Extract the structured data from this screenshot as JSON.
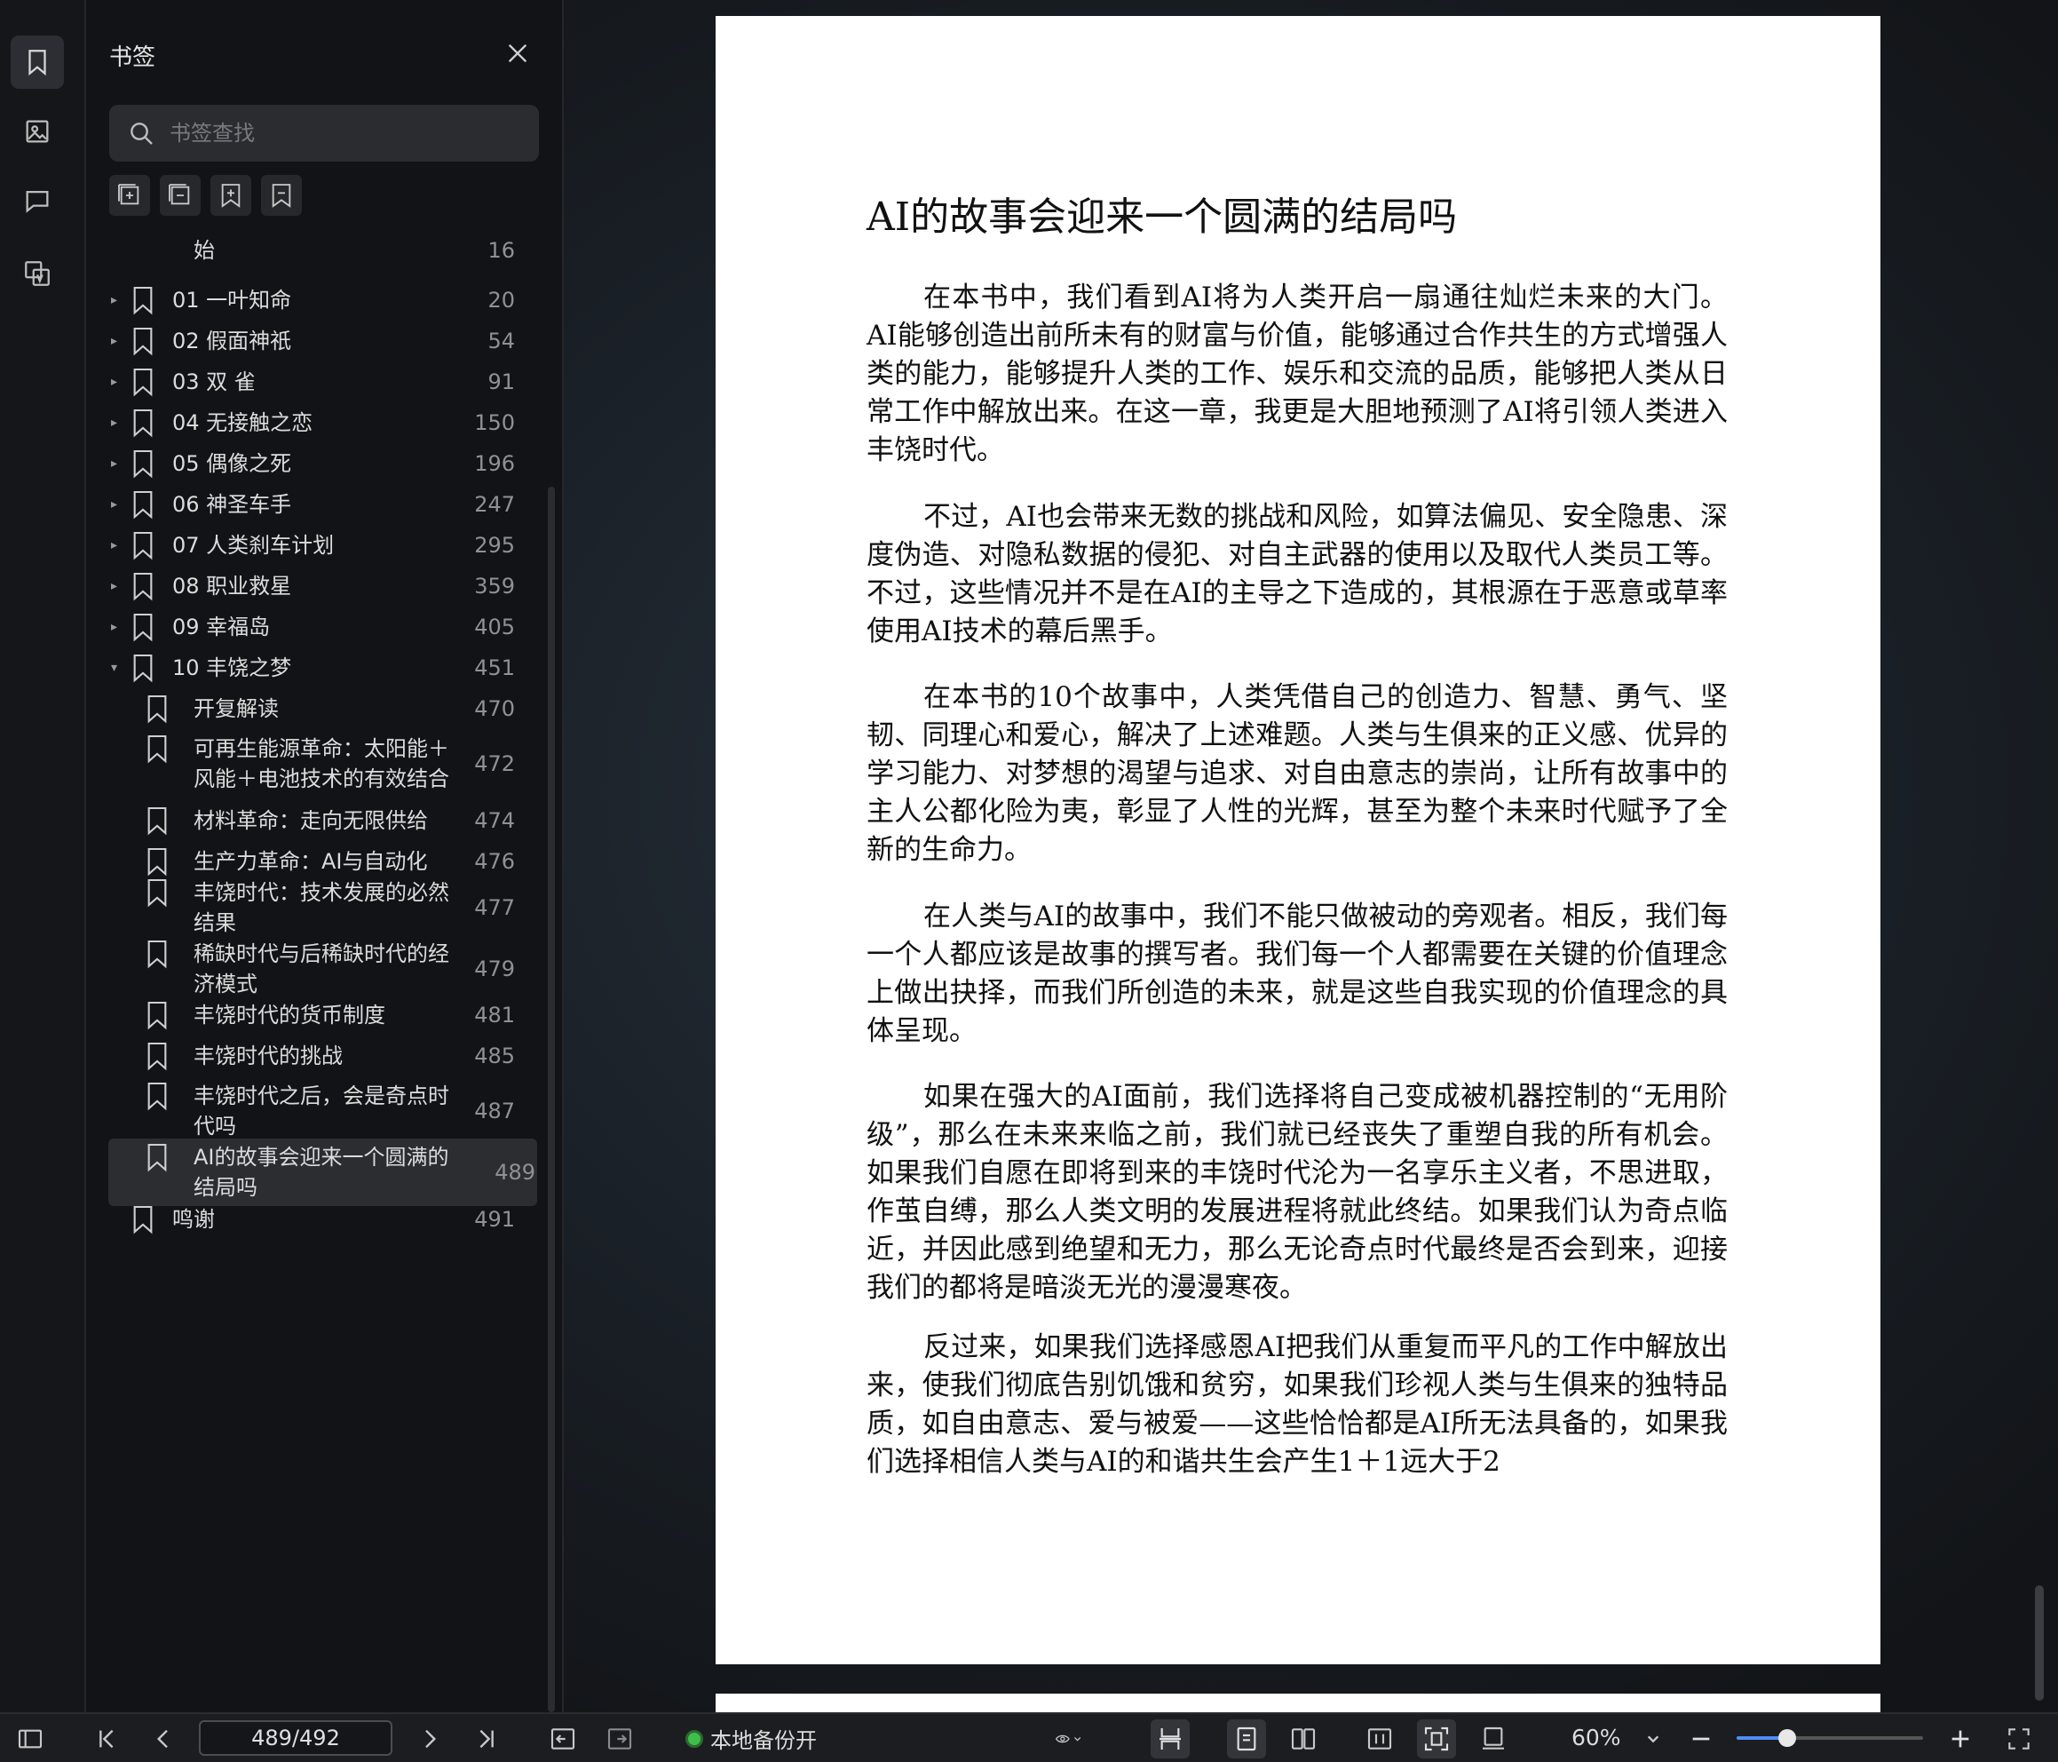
{
  "sidebar": {
    "title": "书签",
    "search_placeholder": "书签查找",
    "items": [
      {
        "label": "始",
        "page": "16",
        "level": 2,
        "arrow": "",
        "icon": false
      },
      {
        "label": "01 一叶知命",
        "page": "20",
        "level": 1,
        "arrow": "▸",
        "icon": true
      },
      {
        "label": "02 假面神祇",
        "page": "54",
        "level": 1,
        "arrow": "▸",
        "icon": true
      },
      {
        "label": "03 双 雀",
        "page": "91",
        "level": 1,
        "arrow": "▸",
        "icon": true
      },
      {
        "label": "04 无接触之恋",
        "page": "150",
        "level": 1,
        "arrow": "▸",
        "icon": true
      },
      {
        "label": "05 偶像之死",
        "page": "196",
        "level": 1,
        "arrow": "▸",
        "icon": true
      },
      {
        "label": "06 神圣车手",
        "page": "247",
        "level": 1,
        "arrow": "▸",
        "icon": true
      },
      {
        "label": "07 人类刹车计划",
        "page": "295",
        "level": 1,
        "arrow": "▸",
        "icon": true
      },
      {
        "label": "08 职业救星",
        "page": "359",
        "level": 1,
        "arrow": "▸",
        "icon": true
      },
      {
        "label": "09 幸福岛",
        "page": "405",
        "level": 1,
        "arrow": "▸",
        "icon": true
      },
      {
        "label": "10 丰饶之梦",
        "page": "451",
        "level": 1,
        "arrow": "▾",
        "icon": true
      },
      {
        "label": "开复解读",
        "page": "470",
        "level": 2,
        "arrow": "",
        "icon": true
      },
      {
        "label": "可再生能源革命：太阳能＋\n风能＋电池技术的有效结合",
        "page": "472",
        "level": 2,
        "arrow": "",
        "icon": true
      },
      {
        "label": "材料革命：走向无限供给",
        "page": "474",
        "level": 2,
        "arrow": "",
        "icon": true
      },
      {
        "label": "生产力革命：AI与自动化",
        "page": "476",
        "level": 2,
        "arrow": "",
        "icon": true
      },
      {
        "label": "丰饶时代：技术发展的必然\n结果",
        "page": "477",
        "level": 2,
        "arrow": "",
        "icon": true
      },
      {
        "label": "稀缺时代与后稀缺时代的经\n济模式",
        "page": "479",
        "level": 2,
        "arrow": "",
        "icon": true
      },
      {
        "label": "丰饶时代的货币制度",
        "page": "481",
        "level": 2,
        "arrow": "",
        "icon": true
      },
      {
        "label": "丰饶时代的挑战",
        "page": "485",
        "level": 2,
        "arrow": "",
        "icon": true
      },
      {
        "label": "丰饶时代之后，会是奇点时\n代吗",
        "page": "487",
        "level": 2,
        "arrow": "",
        "icon": true
      },
      {
        "label": "AI的故事会迎来一个圆满的\n结局吗",
        "page": "489",
        "level": 2,
        "arrow": "",
        "icon": true,
        "selected": true
      },
      {
        "label": "鸣谢",
        "page": "491",
        "level": 1,
        "arrow": "",
        "icon": true
      }
    ]
  },
  "document": {
    "title": "AI的故事会迎来一个圆满的结局吗",
    "paragraphs": [
      "在本书中，我们看到AI将为人类开启一扇通往灿烂未来的大门。AI能够创造出前所未有的财富与价值，能够通过合作共生的方式增强人类的能力，能够提升人类的工作、娱乐和交流的品质，能够把人类从日常工作中解放出来。在这一章，我更是大胆地预测了AI将引领人类进入丰饶时代。",
      "不过，AI也会带来无数的挑战和风险，如算法偏见、安全隐患、深度伪造、对隐私数据的侵犯、对自主武器的使用以及取代人类员工等。不过，这些情况并不是在AI的主导之下造成的，其根源在于恶意或草率使用AI技术的幕后黑手。",
      "在本书的10个故事中，人类凭借自己的创造力、智慧、勇气、坚韧、同理心和爱心，解决了上述难题。人类与生俱来的正义感、优异的学习能力、对梦想的渴望与追求、对自由意志的崇尚，让所有故事中的主人公都化险为夷，彰显了人性的光辉，甚至为整个未来时代赋予了全新的生命力。",
      "在人类与AI的故事中，我们不能只做被动的旁观者。相反，我们每一个人都应该是故事的撰写者。我们每一个人都需要在关键的价值理念上做出抉择，而我们所创造的未来，就是这些自我实现的价值理念的具体呈现。",
      "如果在强大的AI面前，我们选择将自己变成被机器控制的“无用阶级”，那么在未来来临之前，我们就已经丧失了重塑自我的所有机会。如果我们自愿在即将到来的丰饶时代沦为一名享乐主义者，不思进取，作茧自缚，那么人类文明的发展进程将就此终结。如果我们认为奇点临近，并因此感到绝望和无力，那么无论奇点时代最终是否会到来，迎接我们的都将是暗淡无光的漫漫寒夜。",
      "反过来，如果我们选择感恩AI把我们从重复而平凡的工作中解放出来，使我们彻底告别饥饿和贫穷，如果我们珍视人类与生俱来的独特品质，如自由意志、爱与被爱——这些恰恰都是AI所无法具备的，如果我们选择相信人类与AI的和谐共生会产生1＋1远大于2"
    ]
  },
  "toolbar": {
    "page_indicator": "489/492",
    "backup_status": "本地备份开",
    "zoom": "60%",
    "zoom_level": 0.6
  }
}
